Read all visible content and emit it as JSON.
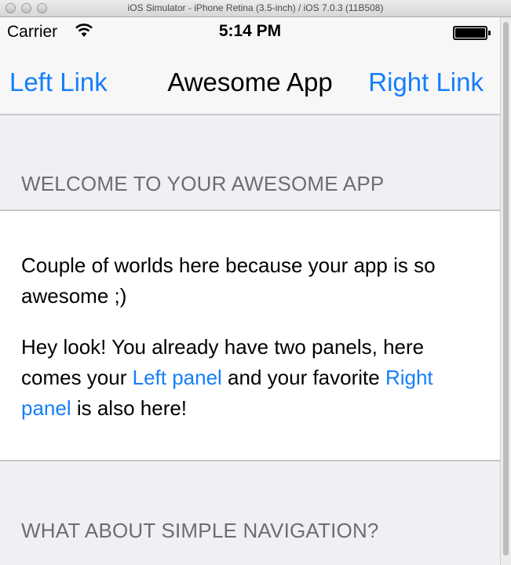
{
  "window": {
    "title": "iOS Simulator - iPhone Retina (3.5-inch) / iOS 7.0.3 (11B508)"
  },
  "status_bar": {
    "carrier": "Carrier",
    "time": "5:14 PM"
  },
  "nav": {
    "left": "Left Link",
    "title": "Awesome App",
    "right": "Right Link"
  },
  "sections": [
    {
      "header": "WELCOME TO YOUR AWESOME APP"
    },
    {
      "header": "WHAT ABOUT SIMPLE NAVIGATION?"
    }
  ],
  "body": {
    "para1": "Couple of worlds here because your app is so awesome ;)",
    "para2_a": "Hey look! You already have two panels, here comes your ",
    "left_panel_link": "Left panel",
    "para2_b": " and your favorite ",
    "right_panel_link": "Right panel",
    "para2_c": " is also here!"
  },
  "colors": {
    "accent": "#157efb",
    "background": "#efeff4",
    "header_text": "#6d6d72"
  }
}
